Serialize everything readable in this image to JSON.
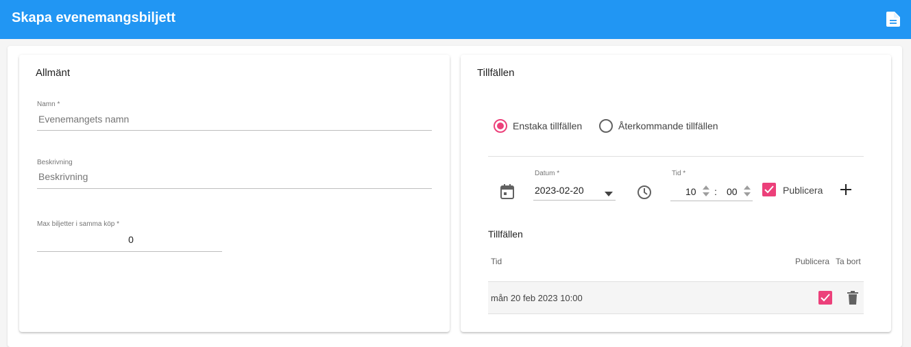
{
  "appbar": {
    "title": "Skapa evenemangsbiljett",
    "doc_icon": "document-icon",
    "color": "#2196f3"
  },
  "general": {
    "title": "Allmänt",
    "name_label": "Namn *",
    "name_placeholder": "Evenemangets namn",
    "description_label": "Beskrivning",
    "description_placeholder": "Beskrivning",
    "max_label": "Max biljetter i samma köp *",
    "max_value": "0"
  },
  "occasions": {
    "title": "Tillfällen",
    "radio_single": "Enstaka tillfällen",
    "radio_recurring": "Återkommande tillfällen",
    "selected_radio": "single",
    "date_label": "Datum *",
    "date_value": "2023-02-20",
    "time_label": "Tid *",
    "hour_value": "10",
    "minute_value": "00",
    "time_separator": ":",
    "publish_label": "Publicera",
    "publish_checked": true,
    "list_title": "Tillfällen",
    "columns": {
      "time": "Tid",
      "publish": "Publicera",
      "delete": "Ta bort"
    },
    "rows": [
      {
        "time": "mån 20 feb 2023 10:00",
        "publish": true
      }
    ],
    "accent": "#ec407a"
  }
}
